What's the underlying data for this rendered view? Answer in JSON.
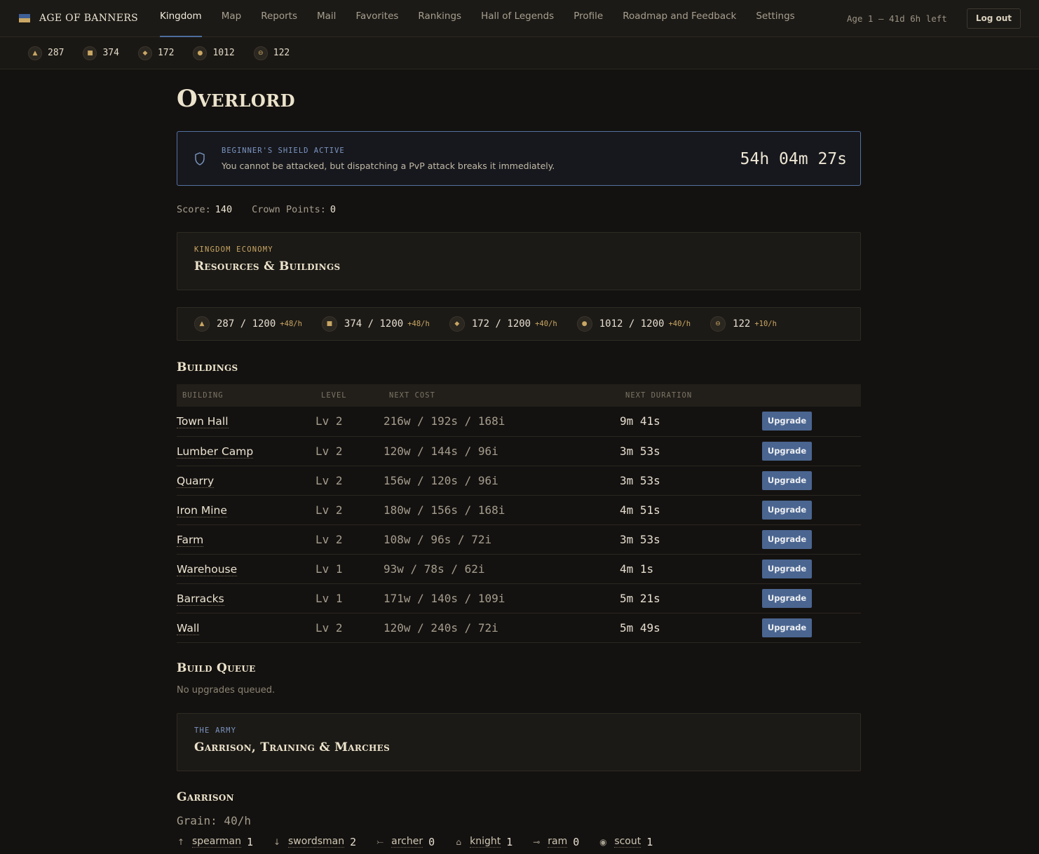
{
  "app": {
    "name": "AGE OF BANNERS",
    "flag_colors": [
      "#3e5f95",
      "#c9a764"
    ]
  },
  "nav": {
    "items": [
      {
        "label": "Kingdom",
        "active": true
      },
      {
        "label": "Map"
      },
      {
        "label": "Reports"
      },
      {
        "label": "Mail"
      },
      {
        "label": "Favorites"
      },
      {
        "label": "Rankings"
      },
      {
        "label": "Hall of Legends"
      },
      {
        "label": "Profile"
      },
      {
        "label": "Roadmap and Feedback"
      },
      {
        "label": "Settings"
      }
    ],
    "age_status": "Age 1 — 41d 6h left",
    "logout_label": "Log out"
  },
  "resources_bar": [
    {
      "icon": "wood-icon",
      "glyph": "▲",
      "value": "287"
    },
    {
      "icon": "stone-icon",
      "glyph": "■",
      "value": "374"
    },
    {
      "icon": "iron-icon",
      "glyph": "◆",
      "value": "172"
    },
    {
      "icon": "grain-icon",
      "glyph": "●",
      "value": "1012"
    },
    {
      "icon": "gold-icon",
      "glyph": "⊖",
      "value": "122"
    }
  ],
  "page": {
    "title": "Overlord"
  },
  "shield": {
    "label": "BEGINNER'S SHIELD ACTIVE",
    "description": "You cannot be attacked, but dispatching a PvP attack breaks it immediately.",
    "timer": "54h 04m 27s"
  },
  "score": {
    "score_label": "Score:",
    "score_value": "140",
    "crown_label": "Crown Points:",
    "crown_value": "0"
  },
  "economy": {
    "kicker": "KINGDOM ECONOMY",
    "heading": "Resources & Buildings",
    "resources": [
      {
        "icon": "wood-icon",
        "glyph": "▲",
        "amount": "287 / 1200",
        "rate": "+48/h"
      },
      {
        "icon": "stone-icon",
        "glyph": "■",
        "amount": "374 / 1200",
        "rate": "+48/h"
      },
      {
        "icon": "iron-icon",
        "glyph": "◆",
        "amount": "172 / 1200",
        "rate": "+40/h"
      },
      {
        "icon": "grain-icon",
        "glyph": "●",
        "amount": "1012 / 1200",
        "rate": "+40/h"
      },
      {
        "icon": "gold-icon",
        "glyph": "⊖",
        "amount": "122",
        "rate": "+10/h"
      }
    ]
  },
  "buildings": {
    "heading": "Buildings",
    "columns": [
      "BUILDING",
      "LEVEL",
      "NEXT COST",
      "NEXT DURATION",
      ""
    ],
    "upgrade_label": "Upgrade",
    "rows": [
      {
        "name": "Town Hall",
        "level": "Lv 2",
        "cost": "216w / 192s / 168i",
        "duration": "9m 41s"
      },
      {
        "name": "Lumber Camp",
        "level": "Lv 2",
        "cost": "120w / 144s / 96i",
        "duration": "3m 53s"
      },
      {
        "name": "Quarry",
        "level": "Lv 2",
        "cost": "156w / 120s / 96i",
        "duration": "3m 53s"
      },
      {
        "name": "Iron Mine",
        "level": "Lv 2",
        "cost": "180w / 156s / 168i",
        "duration": "4m 51s"
      },
      {
        "name": "Farm",
        "level": "Lv 2",
        "cost": "108w / 96s / 72i",
        "duration": "3m 53s"
      },
      {
        "name": "Warehouse",
        "level": "Lv 1",
        "cost": "93w / 78s / 62i",
        "duration": "4m 1s"
      },
      {
        "name": "Barracks",
        "level": "Lv 1",
        "cost": "171w / 140s / 109i",
        "duration": "5m 21s"
      },
      {
        "name": "Wall",
        "level": "Lv 2",
        "cost": "120w / 240s / 72i",
        "duration": "5m 49s"
      }
    ]
  },
  "build_queue": {
    "heading": "Build Queue",
    "empty_text": "No upgrades queued."
  },
  "army": {
    "kicker": "THE ARMY",
    "heading": "Garrison, Training & Marches"
  },
  "garrison": {
    "heading": "Garrison",
    "grain_text": "Grain: 40/h",
    "units": [
      {
        "icon": "spearman-icon",
        "glyph": "↑",
        "name": "spearman",
        "count": "1"
      },
      {
        "icon": "swordsman-icon",
        "glyph": "↓",
        "name": "swordsman",
        "count": "2"
      },
      {
        "icon": "archer-icon",
        "glyph": "⤚",
        "name": "archer",
        "count": "0"
      },
      {
        "icon": "knight-icon",
        "glyph": "⌂",
        "name": "knight",
        "count": "1"
      },
      {
        "icon": "ram-icon",
        "glyph": "⊸",
        "name": "ram",
        "count": "0"
      },
      {
        "icon": "scout-icon",
        "glyph": "◉",
        "name": "scout",
        "count": "1"
      }
    ]
  }
}
